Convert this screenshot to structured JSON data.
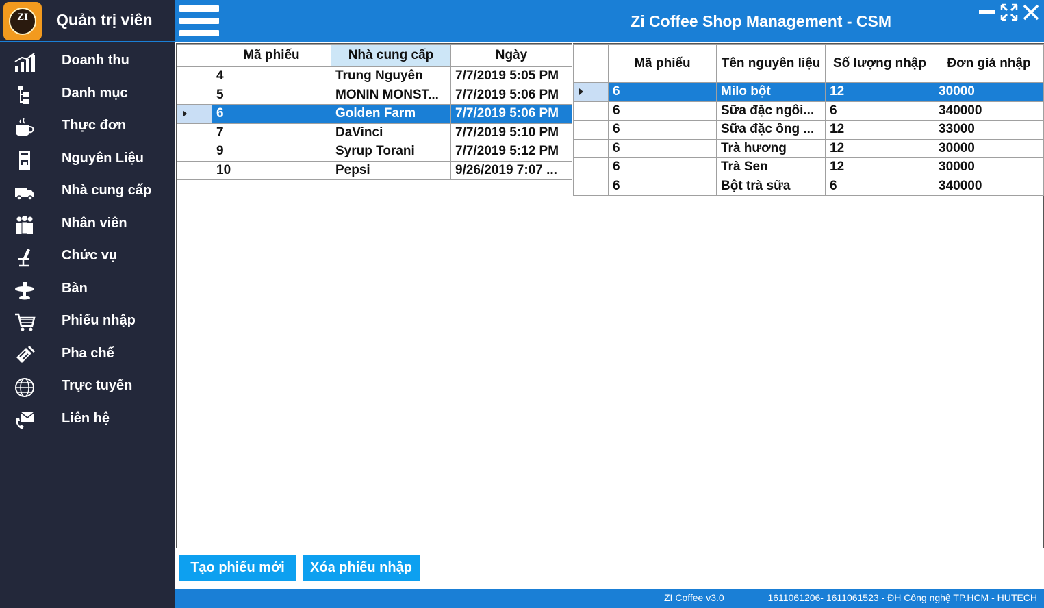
{
  "app": {
    "title": "Zi Coffee Shop Management - CSM",
    "role": "Quản trị viên",
    "logo_text": "ZI"
  },
  "sidebar": {
    "items": [
      {
        "label": "Doanh thu",
        "icon": "chart-icon"
      },
      {
        "label": "Danh mục",
        "icon": "hierarchy-icon"
      },
      {
        "label": "Thực đơn",
        "icon": "coffee-cup-icon"
      },
      {
        "label": "Nguyên Liệu",
        "icon": "coffee-machine-icon"
      },
      {
        "label": "Nhà cung cấp",
        "icon": "truck-icon"
      },
      {
        "label": "Nhân viên",
        "icon": "people-icon"
      },
      {
        "label": "Chức vụ",
        "icon": "chair-icon"
      },
      {
        "label": "Bàn",
        "icon": "table-icon"
      },
      {
        "label": "Phiếu nhập",
        "icon": "cart-icon"
      },
      {
        "label": "Pha chế",
        "icon": "shaker-icon"
      },
      {
        "label": "Trực tuyến",
        "icon": "globe-icon"
      },
      {
        "label": "Liên hệ",
        "icon": "mail-phone-icon"
      }
    ]
  },
  "receipts": {
    "headers": [
      "Mã phiếu",
      "Nhà cung cấp",
      "Ngày"
    ],
    "rows": [
      {
        "id": "4",
        "supplier": "Trung Nguyên",
        "date": "7/7/2019 5:05 PM"
      },
      {
        "id": "5",
        "supplier": "MONIN MONST...",
        "date": "7/7/2019 5:06 PM"
      },
      {
        "id": "6",
        "supplier": "Golden Farm",
        "date": "7/7/2019 5:06 PM"
      },
      {
        "id": "7",
        "supplier": "DaVinci",
        "date": "7/7/2019 5:10 PM"
      },
      {
        "id": "9",
        "supplier": "Syrup Torani",
        "date": "7/7/2019 5:12 PM"
      },
      {
        "id": "10",
        "supplier": "Pepsi",
        "date": "9/26/2019 7:07 ..."
      }
    ],
    "selected_index": 2
  },
  "details": {
    "headers": [
      "Mã phiếu",
      "Tên nguyên liệu",
      "Số lượng nhập",
      "Đơn giá nhập"
    ],
    "rows": [
      {
        "id": "6",
        "ingredient": "Milo bột",
        "qty": "12",
        "price": "30000"
      },
      {
        "id": "6",
        "ingredient": "Sữa đặc ngôi...",
        "qty": "6",
        "price": "340000"
      },
      {
        "id": "6",
        "ingredient": "Sữa đặc ông ...",
        "qty": "12",
        "price": "33000"
      },
      {
        "id": "6",
        "ingredient": "Trà hương",
        "qty": "12",
        "price": "30000"
      },
      {
        "id": "6",
        "ingredient": "Trà Sen",
        "qty": "12",
        "price": "30000"
      },
      {
        "id": "6",
        "ingredient": "Bột trà sữa",
        "qty": "6",
        "price": "340000"
      }
    ],
    "selected_index": 0
  },
  "actions": {
    "create_label": "Tạo phiếu mới",
    "delete_label": "Xóa phiếu nhập"
  },
  "status": {
    "version": "ZI Coffee v3.0",
    "info": "1611061206- 1611061523 - ĐH Công nghệ TP.HCM - HUTECH"
  },
  "colors": {
    "accent": "#1a7fd6",
    "sidebar": "#23283a",
    "button": "#0da0f0"
  }
}
